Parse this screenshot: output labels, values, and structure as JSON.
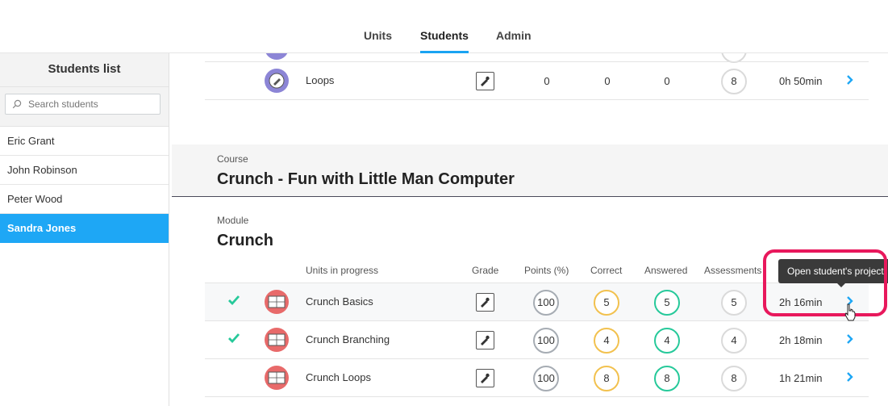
{
  "nav": {
    "tabs": [
      {
        "label": "Units"
      },
      {
        "label": "Students"
      },
      {
        "label": "Admin"
      }
    ],
    "active": "Students"
  },
  "sidebar": {
    "title": "Students list",
    "search_placeholder": "Search students",
    "students": [
      "Eric Grant",
      "John Robinson",
      "Peter Wood",
      "Sandra Jones"
    ],
    "selected": "Sandra Jones"
  },
  "top_row": {
    "name": "Loops",
    "points": "0",
    "correct": "0",
    "answered": "0",
    "assessments": "8",
    "time": "0h 50min"
  },
  "course": {
    "label": "Course",
    "title": "Crunch - Fun with Little Man Computer"
  },
  "module": {
    "label": "Module",
    "title": "Crunch"
  },
  "table_headers": {
    "units": "Units in progress",
    "grade": "Grade",
    "points": "Points (%)",
    "correct": "Correct",
    "answered": "Answered",
    "assessments": "Assessments"
  },
  "units": [
    {
      "name": "Crunch Basics",
      "completed": true,
      "points": "100",
      "correct": "5",
      "answered": "5",
      "assessments": "5",
      "time": "2h 16min"
    },
    {
      "name": "Crunch Branching",
      "completed": true,
      "points": "100",
      "correct": "4",
      "answered": "4",
      "assessments": "4",
      "time": "2h 18min"
    },
    {
      "name": "Crunch Loops",
      "completed": false,
      "points": "100",
      "correct": "8",
      "answered": "8",
      "assessments": "8",
      "time": "1h 21min"
    }
  ],
  "tooltip": "Open student's project",
  "colors": {
    "accent": "#1ea7f5",
    "check": "#26c99a",
    "highlight": "#e8185c"
  }
}
